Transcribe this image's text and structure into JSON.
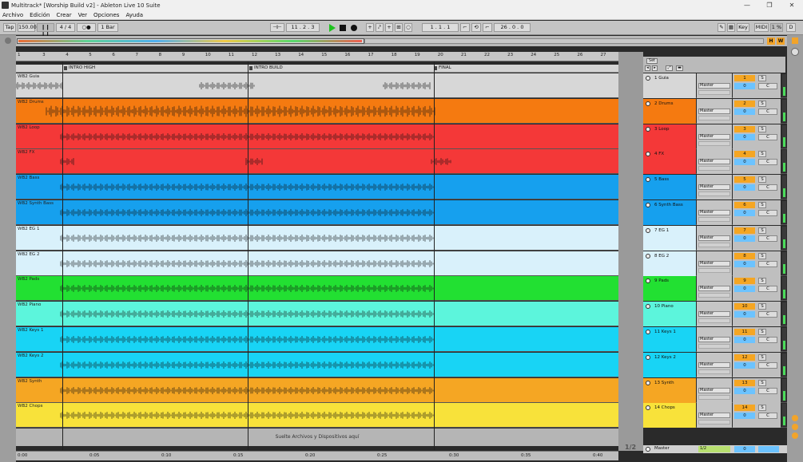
{
  "window": {
    "title": "Multitrack* [Worship Build v2] - Ableton Live 10 Suite",
    "buttons": [
      "—",
      "❐",
      "✕"
    ]
  },
  "menu": [
    "Archivo",
    "Edición",
    "Crear",
    "Ver",
    "Opciones",
    "Ayuda"
  ],
  "control": {
    "tap": "Tap",
    "tempo": "150.00",
    "sig": "4 / 4",
    "metro": "○●",
    "quant": "1 Bar",
    "pos": "11 .  2 .  3",
    "loop_start": "1 .  1 .  1",
    "loop_len": "26 .  0 .  0",
    "key": "Key",
    "midi": "MIDI",
    "cpu": "1 %",
    "d": "D"
  },
  "overview": {
    "h": "H",
    "w": "W"
  },
  "ruler_ticks": [
    "1",
    "3",
    "4",
    "5",
    "6",
    "7",
    "8",
    "9",
    "10",
    "11",
    "12",
    "13",
    "14",
    "15",
    "16",
    "17",
    "18",
    "19",
    "20",
    "21",
    "22",
    "23",
    "24",
    "25",
    "26",
    "27"
  ],
  "locators": [
    {
      "label": "INTRO HIGH"
    },
    {
      "label": "INTRO BUILD"
    },
    {
      "label": "FINAL"
    }
  ],
  "tracks": [
    {
      "clip": "WB2 Guia",
      "mix": "1 Guia",
      "num": "1",
      "color": "#d7d7d7"
    },
    {
      "clip": "WB2 Drums",
      "mix": "2 Drums",
      "num": "2",
      "color": "#f57a10"
    },
    {
      "clip": "WB2 Loop",
      "mix": "3 Loop",
      "num": "3",
      "color": "#f43838"
    },
    {
      "clip": "WB2 FX",
      "mix": "4 FX",
      "num": "4",
      "color": "#f43838"
    },
    {
      "clip": "WB2 Bass",
      "mix": "5 Bass",
      "num": "5",
      "color": "#16a0ee"
    },
    {
      "clip": "WB2 Synth Bass",
      "mix": "6 Synth Bass",
      "num": "6",
      "color": "#16a0ee"
    },
    {
      "clip": "WB2 EG 1",
      "mix": "7 EG 1",
      "num": "7",
      "color": "#d9f1fb"
    },
    {
      "clip": "WB2 EG 2",
      "mix": "8 EG 2",
      "num": "8",
      "color": "#d9f1fb"
    },
    {
      "clip": "WB2 Pads",
      "mix": "9 Pads",
      "num": "9",
      "color": "#22e032"
    },
    {
      "clip": "WB2 Piano",
      "mix": "10 Piano",
      "num": "10",
      "color": "#5cf5dc"
    },
    {
      "clip": "WB2 Keys 1",
      "mix": "11 Keys 1",
      "num": "11",
      "color": "#18d4f5"
    },
    {
      "clip": "WB2 Keys 2",
      "mix": "12 Keys 2",
      "num": "12",
      "color": "#18d4f5"
    },
    {
      "clip": "WB2 Synth",
      "mix": "13 Synth",
      "num": "13",
      "color": "#f5a623"
    },
    {
      "clip": "WB2 Chops",
      "mix": "14 Chops",
      "num": "14",
      "color": "#f8e23a"
    }
  ],
  "mixer": {
    "route": "Master",
    "vol": "0",
    "solo": "S",
    "c": "C",
    "set": "Set"
  },
  "drop_text": "Suelte Archivos y Dispositivos aquí",
  "master": {
    "name": "Master",
    "route": "1/2",
    "vol": "0"
  },
  "page": "1/2",
  "timeline": [
    "0:00",
    "0:05",
    "0:10",
    "0:15",
    "0:20",
    "0:25",
    "0:30",
    "0:35",
    "0:40"
  ]
}
